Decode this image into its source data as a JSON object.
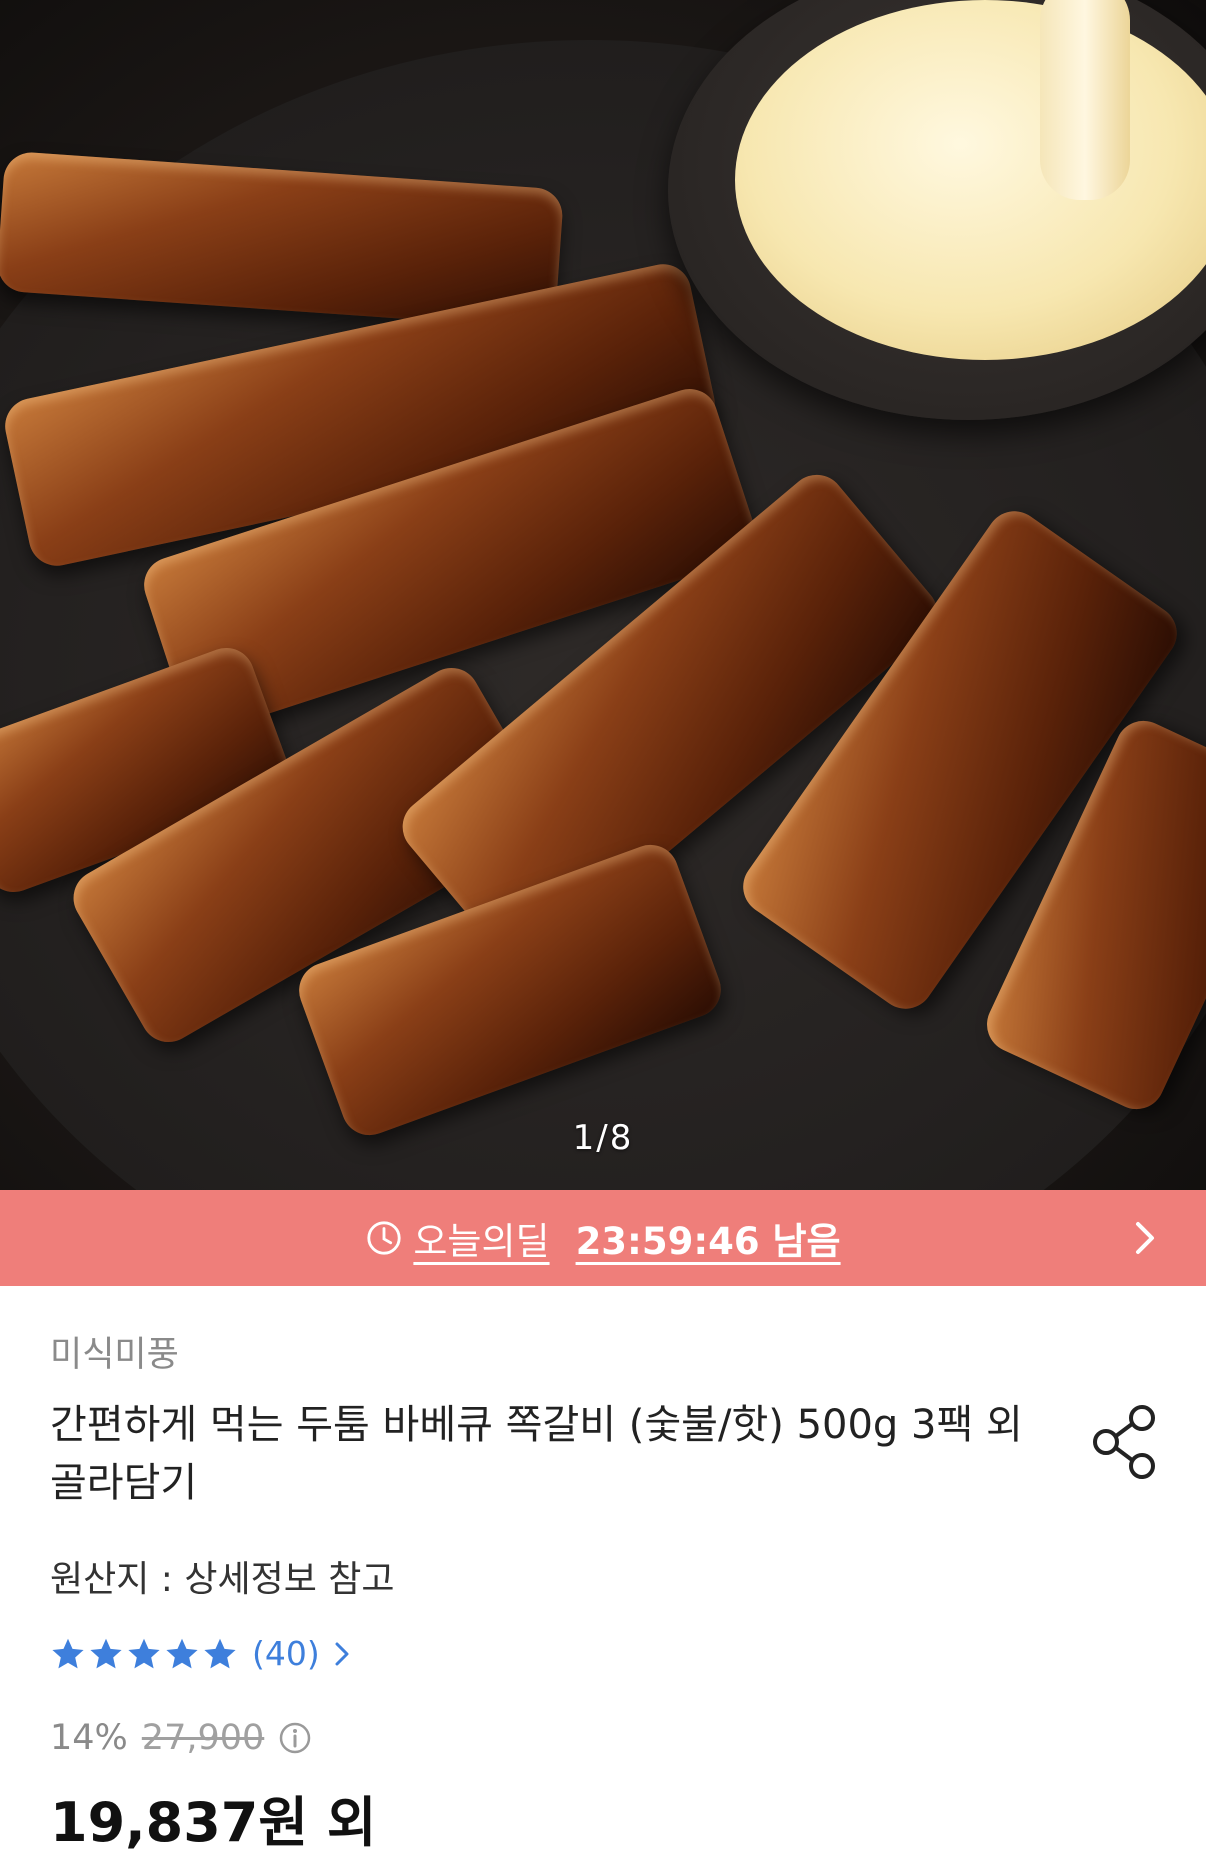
{
  "hero": {
    "image_alt": "barbecue ribs with cheese dip",
    "counter": "1/8"
  },
  "deal": {
    "label": "오늘의딜",
    "countdown": "23:59:46 남음",
    "accent_color": "#ef7e7a"
  },
  "product": {
    "brand": "미식미풍",
    "title": "간편하게 먹는 두툼 바베큐 쪽갈비 (숯불/핫) 500g 3팩 외 골라담기",
    "origin": "원산지 : 상세정보 참고",
    "rating": {
      "stars": 5,
      "review_count": "(40)",
      "star_color": "#3e7fdc"
    },
    "discount": "14%",
    "original_price": "27,900",
    "final_price": "19,837원 외"
  },
  "icons": [
    "clock-icon",
    "chevron-right-icon",
    "share-icon",
    "star-icon",
    "info-icon"
  ]
}
